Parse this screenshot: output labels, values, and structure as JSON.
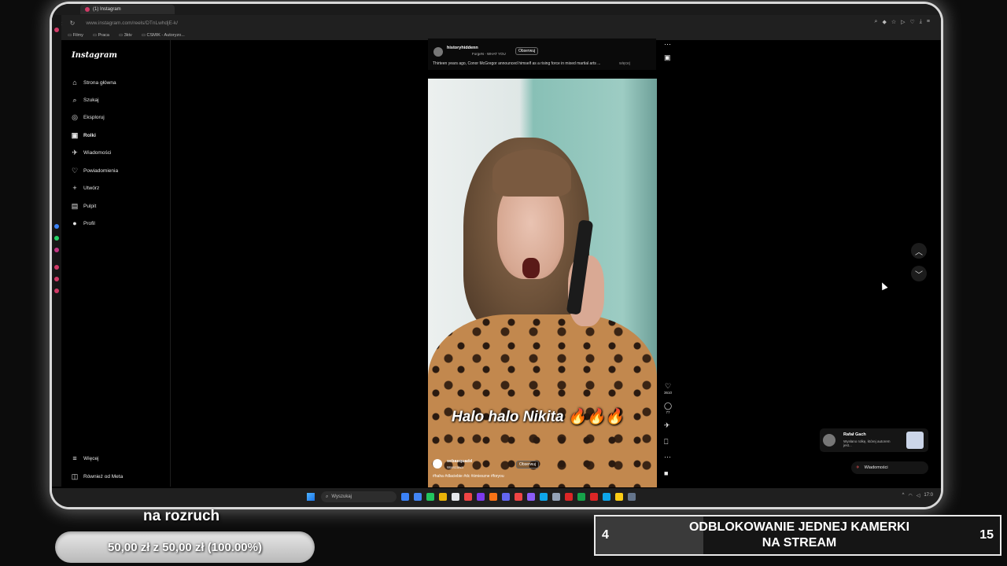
{
  "browser": {
    "tab_title": "(1) Instagram",
    "url": "www.instagram.com/reels/DTnLwhdjE-k/",
    "bookmarks": [
      "Filmy",
      "Praca",
      "3ktv",
      "CSMIK - Autoryzo..."
    ]
  },
  "instagram": {
    "logo": "Instagram",
    "nav": [
      {
        "label": "Strona główna",
        "icon": "home-icon"
      },
      {
        "label": "Szukaj",
        "icon": "search-icon"
      },
      {
        "label": "Eksploruj",
        "icon": "compass-icon"
      },
      {
        "label": "Rolki",
        "icon": "reels-icon"
      },
      {
        "label": "Wiadomości",
        "icon": "messages-icon"
      },
      {
        "label": "Powiadomienia",
        "icon": "heart-icon"
      },
      {
        "label": "Utwórz",
        "icon": "plus-icon"
      },
      {
        "label": "Pulpit",
        "icon": "dashboard-icon"
      },
      {
        "label": "Profil",
        "icon": "profile-icon"
      }
    ],
    "more_label": "Więcej",
    "meta_label": "Również od Meta"
  },
  "post_top": {
    "username": "historyhiddenn",
    "audio": "ForgeN - WHAT YOU",
    "follow": "Obserwuj",
    "caption": "Thirteen years ago, Conor McGregor announced himself as a rising force in mixed martial arts ...",
    "more": "więcej"
  },
  "reel": {
    "overlay_text": "Halo halo Nikita",
    "flames": "🔥🔥🔥",
    "username": "sebasquadd",
    "location": "Warszawa",
    "follow": "Obserwuj",
    "hashtags": "#haha #dlaciebie #dc #śmieszne #foryou",
    "likes": "3610",
    "comments": "77"
  },
  "notification": {
    "name": "Rafał Gach",
    "text": "Wysłano rolkę, której autorem jest..."
  },
  "messages_pill": "Wiadomości",
  "taskbar": {
    "search_placeholder": "Wyszukaj",
    "time": "17:0"
  },
  "overlay": {
    "goal_title": "na rozruch",
    "goal_progress_text": "50,00 zł z 50,00 zł (100.00%)",
    "goal_progress": 1.0,
    "milestone_left": "4",
    "milestone_title_line1": "ODBLOKOWANIE JEDNEJ KAMERKI",
    "milestone_title_line2": "NA STREAM",
    "milestone_right": "15",
    "milestone_progress": 0.2667
  },
  "colors": {
    "brand_accent": "#d03a67",
    "ig_background": "#000000",
    "taskbar": "#1f1f1f"
  }
}
